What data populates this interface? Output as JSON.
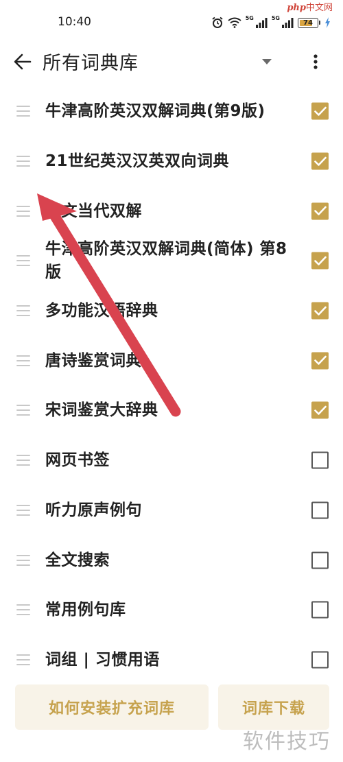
{
  "status_bar": {
    "time": "10:40",
    "network_1": "5G",
    "network_2": "5G",
    "battery_level": "74",
    "battery_fraction": 0.74
  },
  "watermark_top": {
    "prefix": "php",
    "suffix": "中文网"
  },
  "app_bar": {
    "title": "所有词典库"
  },
  "dictionaries": [
    {
      "label": "牛津高阶英汉双解词典(第9版)",
      "checked": true
    },
    {
      "label": "21世纪英汉汉英双向词典",
      "checked": true
    },
    {
      "label": "朗文当代双解",
      "checked": true
    },
    {
      "label": "牛津高阶英汉双解词典(简体) 第8版",
      "checked": true
    },
    {
      "label": "多功能汉语辞典",
      "checked": true
    },
    {
      "label": "唐诗鉴赏词典",
      "checked": true
    },
    {
      "label": "宋词鉴赏大辞典",
      "checked": true
    },
    {
      "label": "网页书签",
      "checked": false
    },
    {
      "label": "听力原声例句",
      "checked": false
    },
    {
      "label": "全文搜索",
      "checked": false
    },
    {
      "label": "常用例句库",
      "checked": false
    },
    {
      "label": "词组 | 习惯用语",
      "checked": false
    }
  ],
  "bottom_buttons": {
    "install_label": "如何安装扩充词库",
    "download_label": "词库下载"
  },
  "watermark_bottom": "软件技巧",
  "colors": {
    "accent": "#c6a24d",
    "annotation_arrow": "#d9434f"
  }
}
